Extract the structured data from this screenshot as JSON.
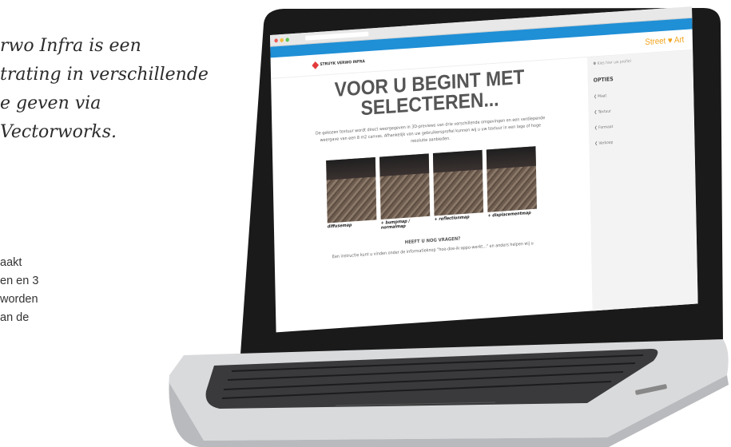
{
  "intro": {
    "lines": [
      "rwo Infra is een",
      "trating in verschillende",
      "e geven via",
      "Vectorworks."
    ]
  },
  "body_text": {
    "lines": [
      "aakt",
      "en en 3",
      "worden",
      "an de"
    ]
  },
  "laptop": {
    "screen": {
      "browser": {},
      "topbar": {
        "items": [
          "",
          "",
          ""
        ]
      },
      "logo_text": "STRUYK VERWO INFRA",
      "brand": "Street ♥ Art",
      "headline_1": "VOOR U BEGINT MET",
      "headline_2": "SELECTEREN...",
      "paragraph": "De gekozen textuur wordt direct weergegeven in 3D-previews van drie verschillende omgevingen en een verdiepende weergave van een 8 m2 canvas. Afhankelijk van uw gebruikersprofiel kunnen wij u uw textuur in een lage of hoge resolutie aanbieden.",
      "thumbnails": [
        {
          "caption": "diffusemap"
        },
        {
          "caption": "+ bumpmap / normalmap"
        },
        {
          "caption": "+ reflectionmap"
        },
        {
          "caption": "+ displacementmap"
        }
      ],
      "question": "HEEFT U NOG VRAGEN?",
      "question_text": "Een instructie kunt u vinden onder de informatieknop \"hoe-doe-ik-appo-werkt...\" en anders helpen wij u",
      "sidebar": {
        "search_placeholder": "Kies hier uw profiel",
        "title": "OPTIES",
        "items": [
          "Maat",
          "Textuur",
          "Formaat",
          "Verkoop"
        ]
      }
    }
  }
}
